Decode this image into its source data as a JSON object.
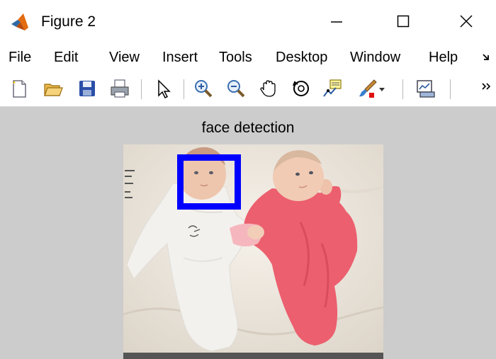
{
  "window": {
    "title": "Figure 2"
  },
  "menu": [
    "File",
    "Edit",
    "View",
    "Insert",
    "Tools",
    "Desktop",
    "Window",
    "Help"
  ],
  "toolbar_icons": [
    "new-figure-icon",
    "open-file-icon",
    "save-icon",
    "print-icon",
    "select-arrow-icon",
    "zoom-in-icon",
    "zoom-out-icon",
    "pan-icon",
    "rotate-3d-icon",
    "data-cursor-icon",
    "brush-icon",
    "brush-dropdown-icon",
    "link-plot-icon",
    "toolbar-overflow-icon"
  ],
  "axes": {
    "title": "face detection"
  },
  "detection": {
    "box_color": "#0000ff"
  },
  "colors": {
    "canvas": "#cccccc",
    "pink_outfit": "#ec5f6e"
  }
}
